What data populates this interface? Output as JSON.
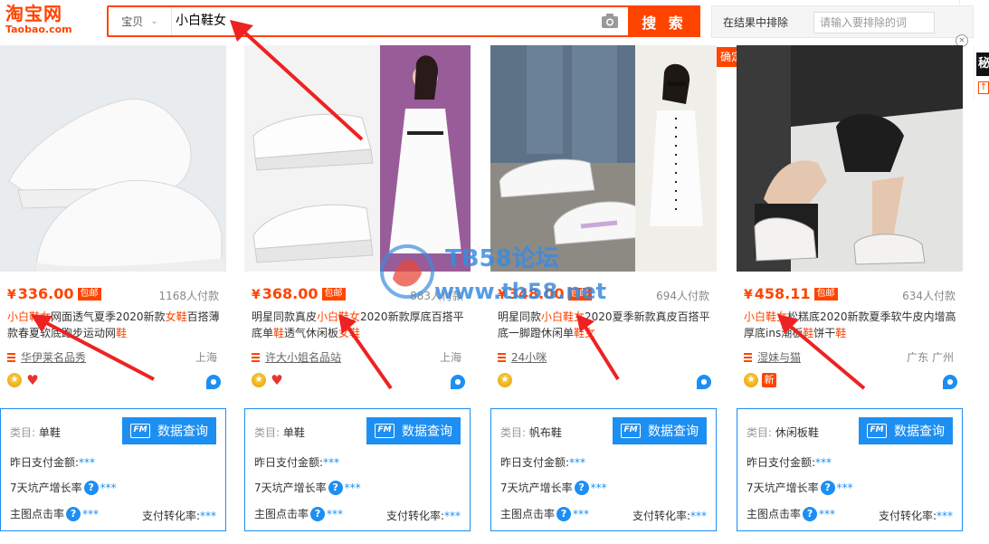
{
  "header": {
    "logo_cn": "淘宝网",
    "logo_en": "Taobao.com",
    "search_category": "宝贝",
    "search_query": "小白鞋女",
    "search_button": "搜 索",
    "exclude_label": "在结果中排除",
    "exclude_placeholder": "请输入要排除的词",
    "confirm_label": "确定",
    "close_label": "×",
    "right_edge_char": "秘"
  },
  "colors": {
    "accent": "#ff4400",
    "blue": "#1d8ff2"
  },
  "products": [
    {
      "price": "336.00",
      "free_ship": "包邮",
      "sold": "1168人付款",
      "title_parts": [
        {
          "t": "小白鞋女",
          "hl": true
        },
        {
          "t": "网面透气夏季2020新款",
          "hl": false
        },
        {
          "t": "女鞋",
          "hl": true
        },
        {
          "t": "百搭薄款春夏软底跑步运动网",
          "hl": false
        },
        {
          "t": "鞋",
          "hl": true
        }
      ],
      "shop": "华伊莱名品秀",
      "location": "上海",
      "badges": [
        "gold-medal-icon",
        "heart-icon"
      ],
      "panel": {
        "category_label": "类目:",
        "category": "单鞋",
        "query_btn": "数据查询",
        "paid_label": "昨日支付金额:",
        "paid_value": "***",
        "growth_label": "7天坑产增长率",
        "growth_value": "***",
        "ctr_label": "主图点击率",
        "ctr_value": "***",
        "conv_label": "支付转化率:",
        "conv_value": "***"
      }
    },
    {
      "price": "368.00",
      "free_ship": "包邮",
      "sold": "883人付款",
      "title_parts": [
        {
          "t": "明星同款真皮",
          "hl": false
        },
        {
          "t": "小白鞋女",
          "hl": true
        },
        {
          "t": "2020新款厚底百搭平底单",
          "hl": false
        },
        {
          "t": "鞋",
          "hl": true
        },
        {
          "t": "透气休闲板",
          "hl": false
        },
        {
          "t": "女鞋",
          "hl": true
        }
      ],
      "shop": "许大小姐名品站",
      "location": "上海",
      "badges": [
        "gold-medal-icon",
        "heart-icon"
      ],
      "panel": {
        "category_label": "类目:",
        "category": "单鞋",
        "query_btn": "数据查询",
        "paid_label": "昨日支付金额:",
        "paid_value": "***",
        "growth_label": "7天坑产增长率",
        "growth_value": "***",
        "ctr_label": "主图点击率",
        "ctr_value": "***",
        "conv_label": "支付转化率:",
        "conv_value": "***"
      }
    },
    {
      "price": "348.00",
      "free_ship": "包邮",
      "sold": "694人付款",
      "title_parts": [
        {
          "t": "明星同款",
          "hl": false
        },
        {
          "t": "小白鞋女",
          "hl": true
        },
        {
          "t": "2020夏季新款真皮百搭平底一脚蹬休闲单",
          "hl": false
        },
        {
          "t": "鞋女",
          "hl": true
        }
      ],
      "shop": "24小咪",
      "location": "",
      "badges": [
        "gold-medal-icon"
      ],
      "panel": {
        "category_label": "类目:",
        "category": "帆布鞋",
        "query_btn": "数据查询",
        "paid_label": "昨日支付金额:",
        "paid_value": "***",
        "growth_label": "7天坑产增长率",
        "growth_value": "***",
        "ctr_label": "主图点击率",
        "ctr_value": "***",
        "conv_label": "支付转化率:",
        "conv_value": "***"
      }
    },
    {
      "price": "458.11",
      "free_ship": "包邮",
      "sold": "634人付款",
      "title_parts": [
        {
          "t": "小白鞋女",
          "hl": true
        },
        {
          "t": "松糕底2020新款夏季软牛皮内增高厚底ins潮",
          "hl": false
        },
        {
          "t": "板",
          "hl": false
        },
        {
          "t": "鞋",
          "hl": true
        },
        {
          "t": "饼干",
          "hl": false
        },
        {
          "t": "鞋",
          "hl": true
        }
      ],
      "shop": "湿妹与猫",
      "location": "广东 广州",
      "badges": [
        "gold-medal-icon",
        "new-icon"
      ],
      "panel": {
        "category_label": "类目:",
        "category": "休闲板鞋",
        "query_btn": "数据查询",
        "paid_label": "昨日支付金额:",
        "paid_value": "***",
        "growth_label": "7天坑产增长率",
        "growth_value": "***",
        "ctr_label": "主图点击率",
        "ctr_value": "***",
        "conv_label": "支付转化率:",
        "conv_value": "***"
      }
    }
  ],
  "watermark": {
    "line1": "TB58论坛",
    "line2": "www.tb58.net"
  },
  "badge_new_label": "新",
  "help_glyph": "?"
}
